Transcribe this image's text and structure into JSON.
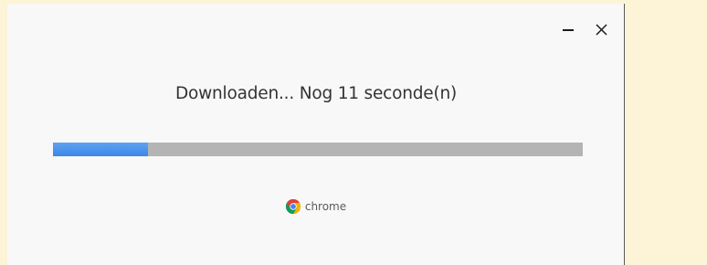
{
  "window": {
    "status_text": "Downloaden... Nog 11 seconde(n)",
    "progress_fraction": 0.18,
    "brand_label": "chrome",
    "controls": {
      "minimize_icon": "minimize-icon",
      "close_icon": "close-icon"
    }
  },
  "colors": {
    "progress_fill": "#3d86e6",
    "progress_track": "#b4b4b4",
    "window_bg": "#f8f8f8",
    "desktop_bg": "#fdf3d6"
  }
}
